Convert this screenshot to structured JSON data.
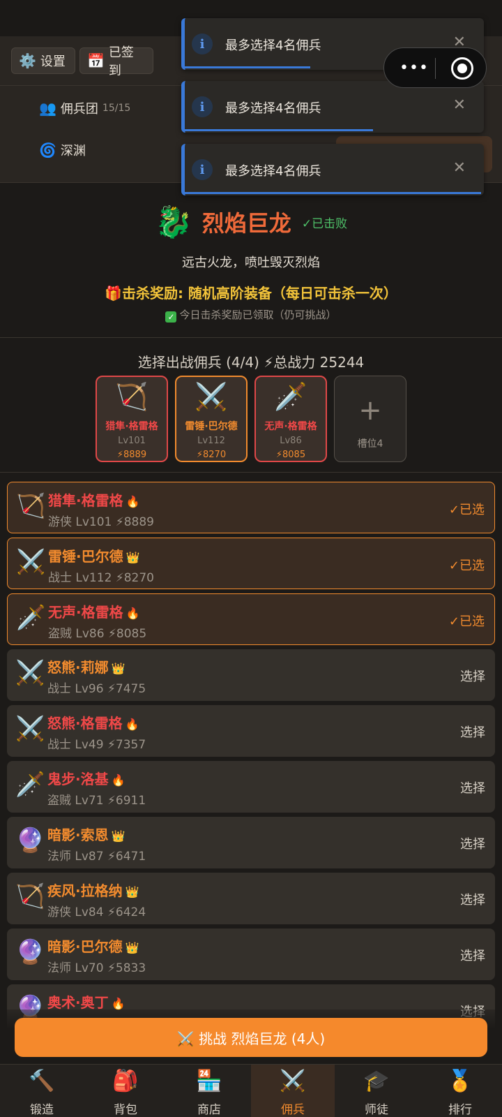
{
  "header": {
    "settings_label": "设置",
    "signed_label": "已签到",
    "nav": {
      "mercenaries_label": "佣兵团",
      "mercenaries_count": "15/15",
      "abyss_label": "深渊"
    }
  },
  "toasts": [
    {
      "icon": "i",
      "text": "最多选择4名佣兵",
      "close": "✕",
      "progress": 0.42
    },
    {
      "icon": "i",
      "text": "最多选择4名佣兵",
      "close": "✕",
      "progress": 0.63
    },
    {
      "icon": "i",
      "text": "最多选择4名佣兵",
      "close": "✕",
      "progress": 0.99
    }
  ],
  "capsule": {
    "more": "•••"
  },
  "boss": {
    "icon": "🐉",
    "name": "烈焰巨龙",
    "defeated": "✓已击败",
    "description": "远古火龙，喷吐毁灭烈焰",
    "reward": "🎁击杀奖励: 随机高阶装备（每日可击杀一次）",
    "claimed_check": "✓",
    "claimed": "今日击杀奖励已领取（仍可挑战）"
  },
  "selection": {
    "title": "选择出战佣兵 (4/4) ⚡总战力 25244",
    "slots": [
      {
        "icon": "🏹",
        "name": "猎隼·格雷格",
        "level": "Lv101",
        "power": "⚡8889",
        "rarity": "red"
      },
      {
        "icon": "⚔️",
        "name": "雷锤·巴尔德",
        "level": "Lv112",
        "power": "⚡8270",
        "rarity": "orange"
      },
      {
        "icon": "🗡️",
        "name": "无声·格雷格",
        "level": "Lv86",
        "power": "⚡8085",
        "rarity": "red"
      }
    ],
    "empty_slot": {
      "plus": "+",
      "label": "槽位4"
    }
  },
  "mercenaries": [
    {
      "icon": "🏹",
      "name": "猎隼·格雷格",
      "tag": "🔥",
      "color": "red",
      "class_level": "游侠 Lv101",
      "power": "⚡8889",
      "action": "✓已选",
      "selected": true
    },
    {
      "icon": "⚔️",
      "name": "雷锤·巴尔德",
      "tag": "👑",
      "color": "orange",
      "class_level": "战士 Lv112",
      "power": "⚡8270",
      "action": "✓已选",
      "selected": true
    },
    {
      "icon": "🗡️",
      "name": "无声·格雷格",
      "tag": "🔥",
      "color": "red",
      "class_level": "盗贼 Lv86",
      "power": "⚡8085",
      "action": "✓已选",
      "selected": true
    },
    {
      "icon": "⚔️",
      "name": "怒熊·莉娜",
      "tag": "👑",
      "color": "orange",
      "class_level": "战士 Lv96",
      "power": "⚡7475",
      "action": "选择",
      "selected": false
    },
    {
      "icon": "⚔️",
      "name": "怒熊·格雷格",
      "tag": "🔥",
      "color": "red",
      "class_level": "战士 Lv49",
      "power": "⚡7357",
      "action": "选择",
      "selected": false
    },
    {
      "icon": "🗡️",
      "name": "鬼步·洛基",
      "tag": "🔥",
      "color": "red",
      "class_level": "盗贼 Lv71",
      "power": "⚡6911",
      "action": "选择",
      "selected": false
    },
    {
      "icon": "🔮",
      "name": "暗影·索恩",
      "tag": "👑",
      "color": "orange",
      "class_level": "法师 Lv87",
      "power": "⚡6471",
      "action": "选择",
      "selected": false
    },
    {
      "icon": "🏹",
      "name": "疾风·拉格纳",
      "tag": "👑",
      "color": "orange",
      "class_level": "游侠 Lv84",
      "power": "⚡6424",
      "action": "选择",
      "selected": false
    },
    {
      "icon": "🔮",
      "name": "暗影·巴尔德",
      "tag": "👑",
      "color": "orange",
      "class_level": "法师 Lv70",
      "power": "⚡5833",
      "action": "选择",
      "selected": false
    },
    {
      "icon": "🔮",
      "name": "奥术·奥丁",
      "tag": "🔥",
      "color": "red",
      "class_level": "",
      "power": "",
      "action": "选择",
      "selected": false
    }
  ],
  "cta_label": "⚔️ 挑战 烈焰巨龙 (4人)",
  "tabs": [
    {
      "icon": "🔨",
      "label": "锻造",
      "active": false
    },
    {
      "icon": "🎒",
      "label": "背包",
      "active": false
    },
    {
      "icon": "🏪",
      "label": "商店",
      "active": false
    },
    {
      "icon": "⚔️",
      "label": "佣兵",
      "active": true
    },
    {
      "icon": "🎓",
      "label": "师徒",
      "active": false
    },
    {
      "icon": "🏅",
      "label": "排行",
      "active": false
    }
  ]
}
